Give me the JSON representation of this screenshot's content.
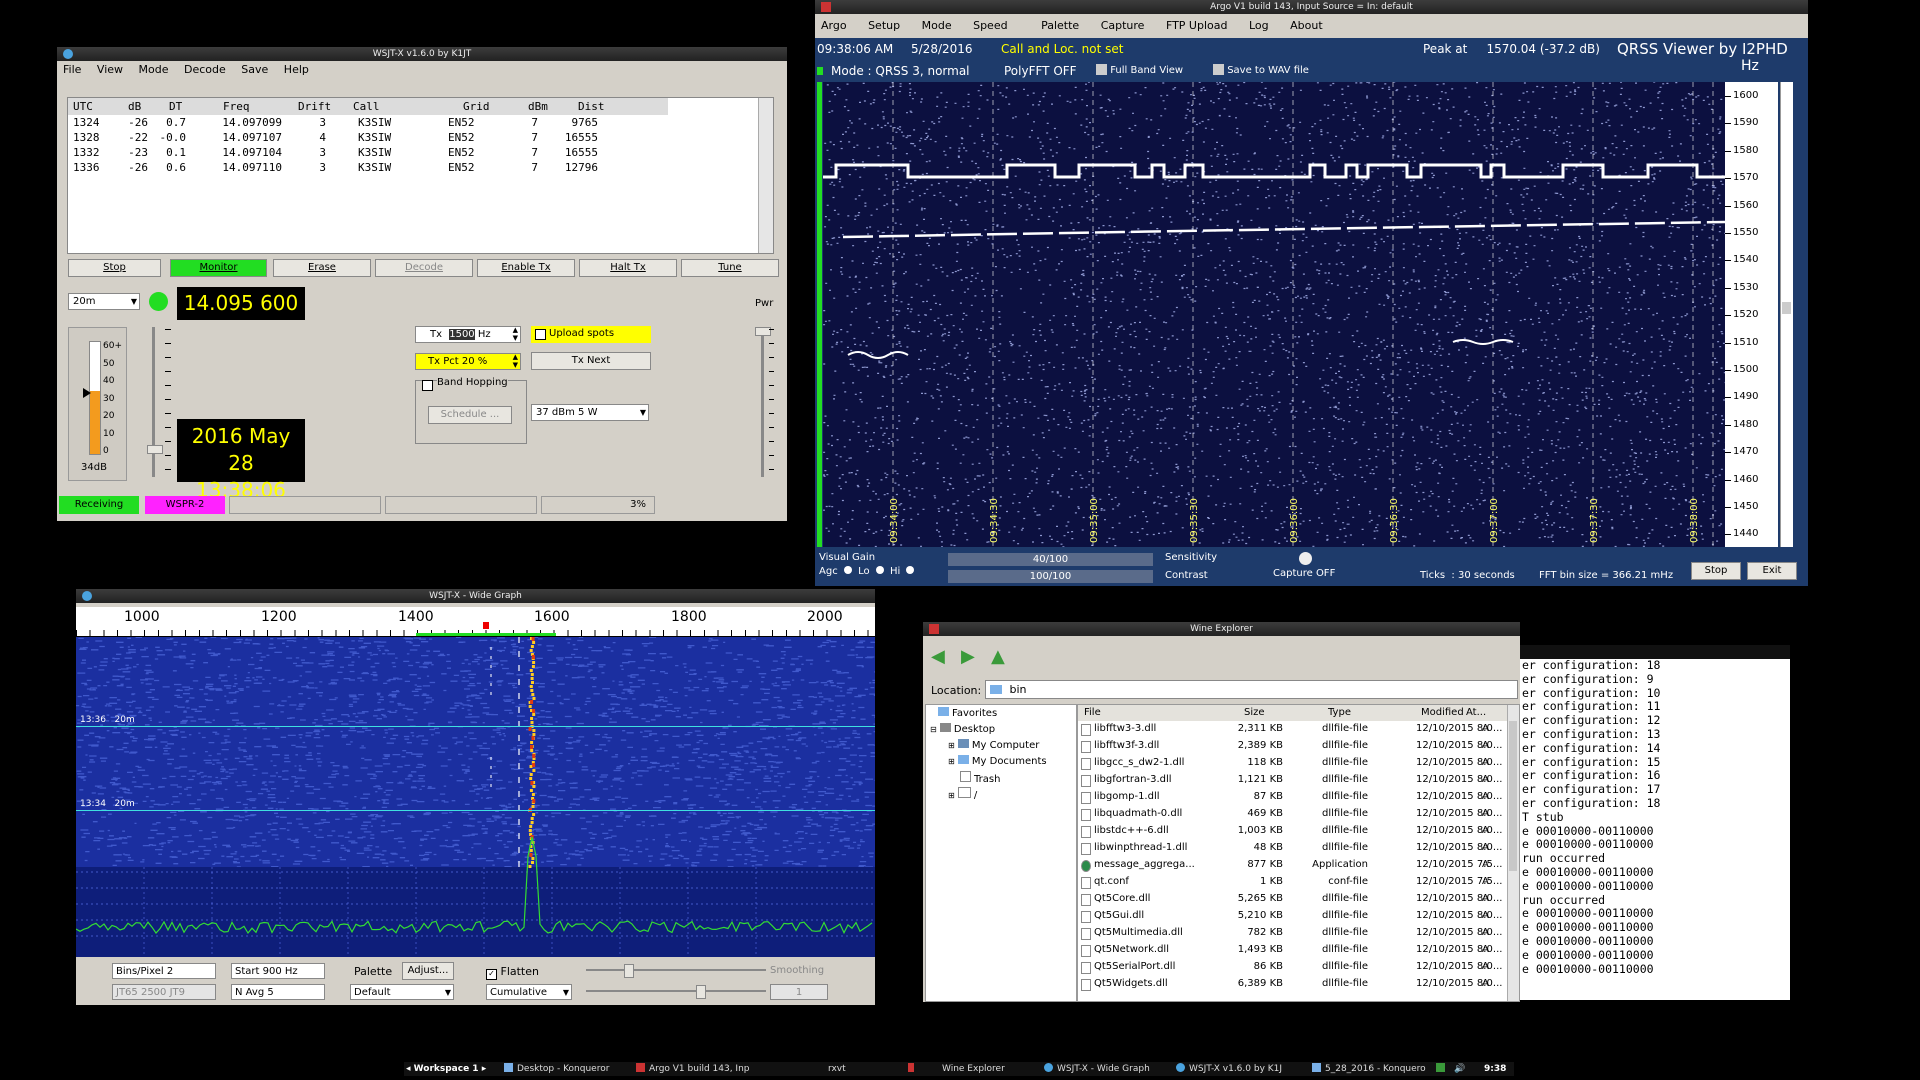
{
  "wsjtx": {
    "title": "WSJT-X   v1.6.0   by K1JT",
    "menu": [
      "File",
      "View",
      "Mode",
      "Decode",
      "Save",
      "Help"
    ],
    "columns": [
      "UTC",
      "dB",
      "DT",
      "Freq",
      "Drift",
      "Call",
      "Grid",
      "dBm",
      "Dist"
    ],
    "rows": [
      [
        "1324",
        "-26",
        "0.7",
        "14.097099",
        "3",
        "K3SIW",
        "EN52",
        "7",
        "9765"
      ],
      [
        "1328",
        "-22",
        "-0.0",
        "14.097107",
        "4",
        "K3SIW",
        "EN52",
        "7",
        "16555"
      ],
      [
        "1332",
        "-23",
        "0.1",
        "14.097104",
        "3",
        "K3SIW",
        "EN52",
        "7",
        "16555"
      ],
      [
        "1336",
        "-26",
        "0.6",
        "14.097110",
        "3",
        "K3SIW",
        "EN52",
        "7",
        "12796"
      ]
    ],
    "buttons": [
      "Stop",
      "Monitor",
      "Erase",
      "Decode",
      "Enable Tx",
      "Halt Tx",
      "Tune"
    ],
    "band": "20m",
    "dial_freq": "14.095 600",
    "date": "2016 May 28",
    "time": "13:38:06",
    "meter_scale": [
      "60+",
      "50",
      "40",
      "30",
      "20",
      "10",
      "0"
    ],
    "meter_db": "34dB",
    "tx_prefix": "Tx",
    "tx_value": "1500",
    "tx_unit": "Hz",
    "tx_pct": "Tx Pct 20  %",
    "tx_next": "Tx Next",
    "upload_spots": "Upload spots",
    "band_hopping": "Band Hopping",
    "schedule": "Schedule ...",
    "power": "37 dBm  5 W",
    "pwr_label": "Pwr",
    "status": [
      "Receiving",
      "WSPR-2"
    ],
    "progress": "3%",
    "colors": {
      "monitor": "#22dd22",
      "receiving": "#22dd22",
      "wspr": "#ff22ff",
      "lcd_text": "#ffff00",
      "highlight": "#ffff00"
    }
  },
  "argo": {
    "title": "Argo V1 build 143, Input Source = In: default",
    "menu": [
      "Argo",
      "Setup",
      "Mode",
      "Speed",
      "Palette",
      "Capture",
      "FTP Upload",
      "Log",
      "About"
    ],
    "time": "09:38:06 AM",
    "date": "5/28/2016",
    "call_loc": "Call and Loc. not set",
    "peak": "Peak at     1570.04 (-37.2 dB)",
    "qrss_viewer": "QRSS Viewer by I2PHD",
    "hz": "Hz",
    "mode": "Mode : QRSS 3, normal",
    "polyfft": "PolyFFT OFF",
    "full_band": "Full Band View",
    "save_wav": "Save to WAV file",
    "freq_labels": [
      "1600",
      "1590",
      "1580",
      "1570",
      "1560",
      "1550",
      "1540",
      "1530",
      "1520",
      "1510",
      "1500",
      "1490",
      "1480",
      "1470",
      "1460",
      "1450",
      "1440"
    ],
    "time_labels": [
      "09:34:00",
      "09:34:30",
      "09:35:00",
      "09:35:30",
      "09:36:00",
      "09:36:30",
      "09:37:00",
      "09:37:30",
      "09:38:00"
    ],
    "visual_gain": "Visual Gain",
    "agc": "Agc",
    "lo": "Lo",
    "hi": "Hi",
    "bar1": "40/100",
    "bar2": "100/100",
    "sensitivity": "Sensitivity",
    "contrast": "Contrast",
    "capture": "Capture OFF",
    "ticks": "Ticks  : 30 seconds",
    "fft_bin": "FFT bin size = 366.21 mHz",
    "stop": "Stop",
    "exit": "Exit"
  },
  "widegraph": {
    "title": "WSJT-X - Wide Graph",
    "axis": [
      "1000",
      "1200",
      "1400",
      "1600",
      "1800",
      "2000"
    ],
    "markers": [
      "13:36   20m",
      "13:34   20m"
    ],
    "bins_label": "Bins/Pixel  2",
    "start_label": "Start 900 Hz",
    "jt_label": "JT65  2500  JT9",
    "navg_label": "N Avg  5",
    "palette": "Palette",
    "adjust": "Adjust...",
    "default": "Default",
    "flatten": "Flatten",
    "cumulative": "Cumulative",
    "smoothing": "Smoothing",
    "smooth_val": "1"
  },
  "explorer": {
    "title": "Wine Explorer",
    "location_label": "Location:",
    "location": "bin",
    "tree": [
      "Favorites",
      "Desktop",
      "My Computer",
      "My Documents",
      "Trash",
      "/"
    ],
    "columns": [
      "File",
      "Size",
      "Type",
      "Modified",
      "At..."
    ],
    "files": [
      [
        "libfftw3-3.dll",
        "2,311 KB",
        "dllfile-file",
        "12/10/2015 8:0...",
        "A"
      ],
      [
        "libfftw3f-3.dll",
        "2,389 KB",
        "dllfile-file",
        "12/10/2015 8:0...",
        "A"
      ],
      [
        "libgcc_s_dw2-1.dll",
        "118 KB",
        "dllfile-file",
        "12/10/2015 8:0...",
        "A"
      ],
      [
        "libgfortran-3.dll",
        "1,121 KB",
        "dllfile-file",
        "12/10/2015 8:0...",
        "A"
      ],
      [
        "libgomp-1.dll",
        "87 KB",
        "dllfile-file",
        "12/10/2015 8:0...",
        "A"
      ],
      [
        "libquadmath-0.dll",
        "469 KB",
        "dllfile-file",
        "12/10/2015 8:0...",
        "A"
      ],
      [
        "libstdc++-6.dll",
        "1,003 KB",
        "dllfile-file",
        "12/10/2015 8:0...",
        "A"
      ],
      [
        "libwinpthread-1.dll",
        "48 KB",
        "dllfile-file",
        "12/10/2015 8:0...",
        "A"
      ],
      [
        "message_aggrega...",
        "877 KB",
        "Application",
        "12/10/2015 7:5...",
        "A"
      ],
      [
        "qt.conf",
        "1 KB",
        "conf-file",
        "12/10/2015 7:5...",
        "A"
      ],
      [
        "Qt5Core.dll",
        "5,265 KB",
        "dllfile-file",
        "12/10/2015 8:0...",
        "A"
      ],
      [
        "Qt5Gui.dll",
        "5,210 KB",
        "dllfile-file",
        "12/10/2015 8:0...",
        "A"
      ],
      [
        "Qt5Multimedia.dll",
        "782 KB",
        "dllfile-file",
        "12/10/2015 8:0...",
        "A"
      ],
      [
        "Qt5Network.dll",
        "1,493 KB",
        "dllfile-file",
        "12/10/2015 8:0...",
        "A"
      ],
      [
        "Qt5SerialPort.dll",
        "86 KB",
        "dllfile-file",
        "12/10/2015 8:0...",
        "A"
      ],
      [
        "Qt5Widgets.dll",
        "6,389 KB",
        "dllfile-file",
        "12/10/2015 8:0...",
        "A"
      ]
    ]
  },
  "rxvt": {
    "lines": [
      "er configuration: 18",
      "er configuration: 9",
      "er configuration: 10",
      "er configuration: 11",
      "er configuration: 12",
      "er configuration: 13",
      "er configuration: 14",
      "er configuration: 15",
      "er configuration: 16",
      "er configuration: 17",
      "er configuration: 18",
      "T stub",
      "e 00010000-00110000",
      "e 00010000-00110000",
      "run occurred",
      "e 00010000-00110000",
      "e 00010000-00110000",
      "run occurred",
      "e 00010000-00110000",
      "e 00010000-00110000",
      "e 00010000-00110000",
      "e 00010000-00110000",
      "e 00010000-00110000"
    ]
  },
  "taskbar": {
    "workspace": "◂ Workspace 1 ▸",
    "items": [
      "Desktop - Konqueror",
      "Argo V1 build 143, Inp",
      "rxvt",
      "Wine Explorer",
      "WSJT-X - Wide Graph",
      "WSJT-X   v1.6.0   by K1J",
      "5_28_2016 - Konquero"
    ],
    "clock": "9:38"
  }
}
